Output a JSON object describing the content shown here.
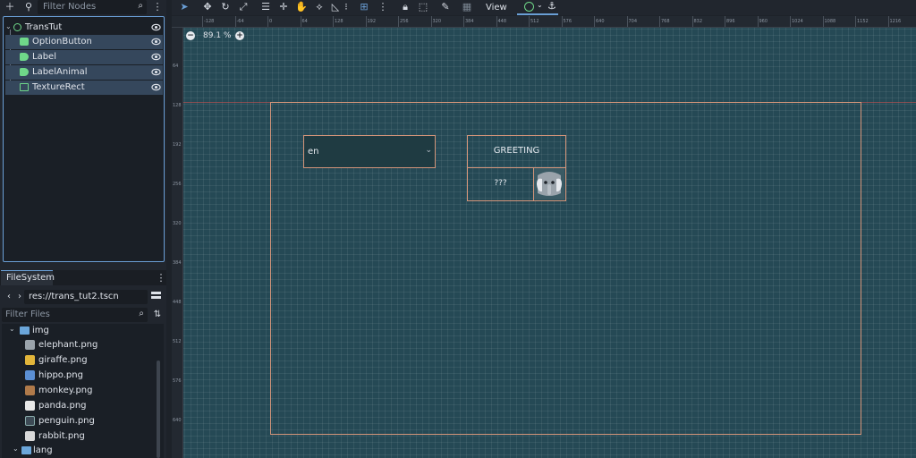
{
  "scene_panel": {
    "filter_placeholder": "Filter Nodes",
    "nodes": [
      {
        "label": "TransTut",
        "icon": "node-circle-icon"
      },
      {
        "label": "OptionButton",
        "icon": "option-button-icon"
      },
      {
        "label": "Label",
        "icon": "label-icon"
      },
      {
        "label": "LabelAnimal",
        "icon": "label-icon"
      },
      {
        "label": "TextureRect",
        "icon": "texture-rect-icon"
      }
    ]
  },
  "filesystem": {
    "tab_label": "FileSystem",
    "path": "res://trans_tut2.tscn",
    "filter_placeholder": "Filter Files",
    "items": [
      {
        "label": "img",
        "type": "folder"
      },
      {
        "label": "elephant.png",
        "type": "file",
        "color": "#9aa3ab"
      },
      {
        "label": "giraffe.png",
        "type": "file",
        "color": "#e2b53a"
      },
      {
        "label": "hippo.png",
        "type": "file",
        "color": "#5b8fd4"
      },
      {
        "label": "monkey.png",
        "type": "file",
        "color": "#b07a4a"
      },
      {
        "label": "panda.png",
        "type": "file",
        "color": "#e8e8e8"
      },
      {
        "label": "penguin.png",
        "type": "file",
        "color": "#3d4a55"
      },
      {
        "label": "rabbit.png",
        "type": "file",
        "color": "#d9d9d9"
      },
      {
        "label": "lang",
        "type": "folder"
      }
    ]
  },
  "toolbar": {
    "view_label": "View"
  },
  "viewport": {
    "zoom": "89.1 %",
    "ruler_top": [
      "-128",
      "-64",
      "0",
      "64",
      "128",
      "192",
      "256",
      "320",
      "384",
      "448",
      "512",
      "576",
      "640",
      "704",
      "768",
      "832",
      "896",
      "960",
      "1024",
      "1088",
      "1152",
      "1216"
    ],
    "ruler_left": [
      "64",
      "128",
      "192",
      "256",
      "320",
      "384",
      "448",
      "512",
      "576",
      "640"
    ],
    "option_button_text": "en",
    "label_text": "GREETING",
    "label_animal_text": "???"
  },
  "colors": {
    "accent": "#6a9fd6",
    "canvas": "#254955",
    "node_outline": "#d4957a",
    "control_icon": "#6fd889"
  }
}
